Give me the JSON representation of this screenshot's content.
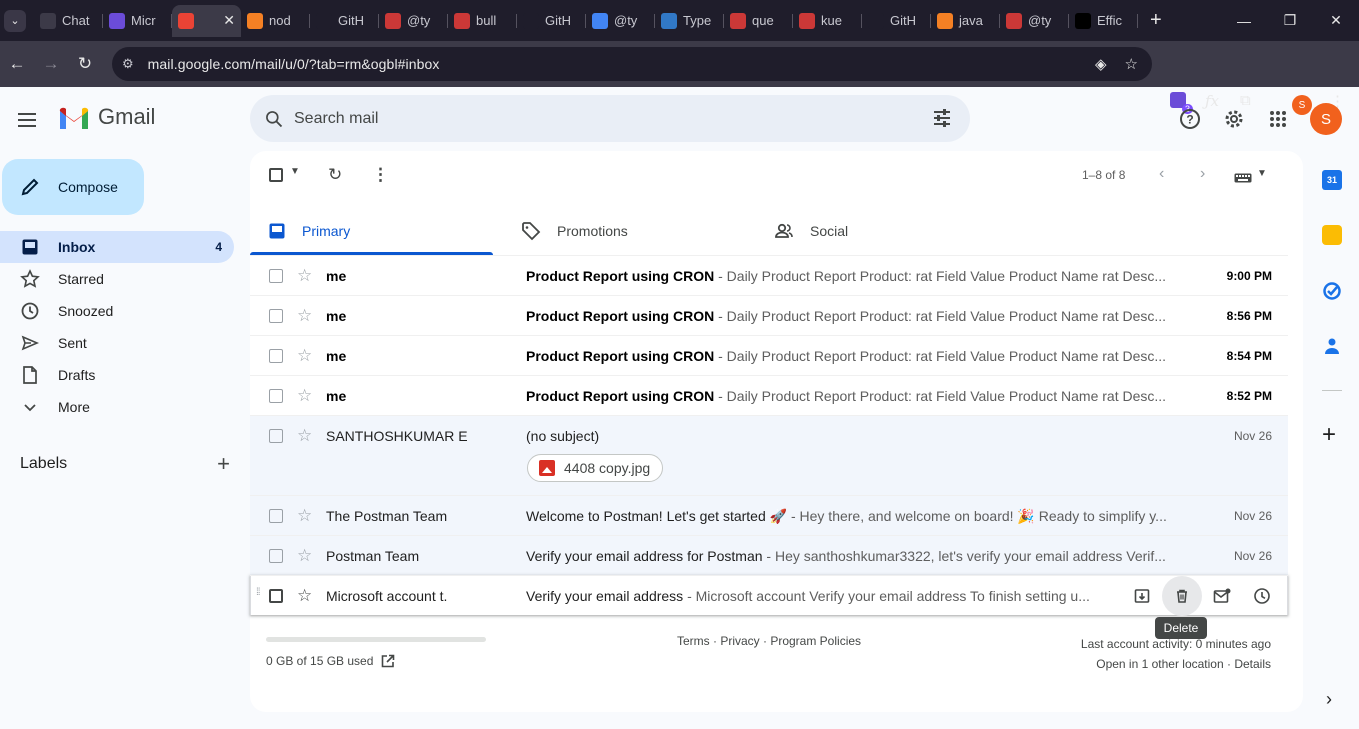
{
  "browser": {
    "tabs": [
      {
        "label": "Chat",
        "icon": "chatgpt-icon",
        "color": "#3c3a48"
      },
      {
        "label": "Micr",
        "icon": "copilot-icon",
        "color": "#6b4cd8"
      },
      {
        "label": "",
        "icon": "gmail-icon",
        "color": "#ea4335",
        "active": true
      },
      {
        "label": "nod",
        "icon": "stackoverflow-icon",
        "color": "#f48024"
      },
      {
        "label": "GitH",
        "icon": "github-icon",
        "color": "#1f1d2b"
      },
      {
        "label": "@ty",
        "icon": "npm-icon",
        "color": "#cb3837"
      },
      {
        "label": "bull",
        "icon": "npm-icon",
        "color": "#cb3837"
      },
      {
        "label": "GitH",
        "icon": "github-icon",
        "color": "#1f1d2b"
      },
      {
        "label": "@ty",
        "icon": "google-icon",
        "color": "#4285f4"
      },
      {
        "label": "Type",
        "icon": "typescript-icon",
        "color": "#3178c6"
      },
      {
        "label": "que",
        "icon": "npm-icon",
        "color": "#cb3837"
      },
      {
        "label": "kue",
        "icon": "npm-icon",
        "color": "#cb3837"
      },
      {
        "label": "GitH",
        "icon": "github-icon",
        "color": "#1f1d2b"
      },
      {
        "label": "java",
        "icon": "stackoverflow-icon",
        "color": "#f48024"
      },
      {
        "label": "@ty",
        "icon": "npm-icon",
        "color": "#cb3837"
      },
      {
        "label": "Effic",
        "icon": "medium-icon",
        "color": "#000000"
      }
    ],
    "url": "mail.google.com/mail/u/0/?tab=rm&ogbl#inbox",
    "extension_badge": "3",
    "profile_initial": "S"
  },
  "gmail": {
    "product_name": "Gmail",
    "search_placeholder": "Search mail",
    "avatar_initial": "S",
    "compose_label": "Compose",
    "nav": [
      {
        "label": "Inbox",
        "icon": "inbox-icon",
        "count": "4",
        "active": true
      },
      {
        "label": "Starred",
        "icon": "star-icon",
        "count": ""
      },
      {
        "label": "Snoozed",
        "icon": "clock-icon",
        "count": ""
      },
      {
        "label": "Sent",
        "icon": "send-icon",
        "count": ""
      },
      {
        "label": "Drafts",
        "icon": "draft-icon",
        "count": ""
      },
      {
        "label": "More",
        "icon": "chevron-down-icon",
        "count": ""
      }
    ],
    "labels_heading": "Labels",
    "pagination": "1–8 of 8",
    "inbox_tabs": [
      {
        "label": "Primary",
        "icon": "inbox-icon",
        "active": true
      },
      {
        "label": "Promotions",
        "icon": "tag-icon"
      },
      {
        "label": "Social",
        "icon": "people-icon"
      }
    ],
    "emails": [
      {
        "sender": "me",
        "subject": "Product Report using CRON",
        "snippet": " - Daily Product Report Product: rat Field Value Product Name rat Desc...",
        "date": "9:00 PM",
        "unread": true
      },
      {
        "sender": "me",
        "subject": "Product Report using CRON",
        "snippet": " - Daily Product Report Product: rat Field Value Product Name rat Desc...",
        "date": "8:56 PM",
        "unread": true
      },
      {
        "sender": "me",
        "subject": "Product Report using CRON",
        "snippet": " - Daily Product Report Product: rat Field Value Product Name rat Desc...",
        "date": "8:54 PM",
        "unread": true
      },
      {
        "sender": "me",
        "subject": "Product Report using CRON",
        "snippet": " - Daily Product Report Product: rat Field Value Product Name rat Desc...",
        "date": "8:52 PM",
        "unread": true
      },
      {
        "sender": "SANTHOSHKUMAR E",
        "subject": "(no subject)",
        "snippet": "",
        "date": "Nov 26",
        "unread": false,
        "attachment": "4408 copy.jpg"
      },
      {
        "sender": "The Postman Team",
        "subject": "Welcome to Postman! Let's get started 🚀",
        "snippet": " - Hey there, and welcome on board! 🎉 Ready to simplify y...",
        "date": "Nov 26",
        "unread": false
      },
      {
        "sender": "Postman Team",
        "subject": "Verify your email address for Postman",
        "snippet": " - Hey santhoshkumar3322, let's verify your email address Verif...",
        "date": "Nov 26",
        "unread": false
      },
      {
        "sender": "Microsoft account t.",
        "subject": "Verify your email address",
        "snippet": " - Microsoft account Verify your email address To finish setting u...",
        "date": "",
        "unread": false,
        "hovered": true
      }
    ],
    "tooltip": "Delete",
    "storage": "0 GB of 15 GB used",
    "footer_links": "Terms · Privacy · Program Policies",
    "last_activity": "Last account activity: 0 minutes ago",
    "other_location": "Open in 1 other location · Details",
    "side_panel": [
      {
        "name": "calendar-icon",
        "text": "31",
        "color": "#1a73e8"
      },
      {
        "name": "keep-icon",
        "text": "",
        "color": "#fbbc04"
      },
      {
        "name": "tasks-icon",
        "text": "",
        "color": "#1a73e8"
      },
      {
        "name": "contacts-icon",
        "text": "",
        "color": "#1a73e8"
      }
    ]
  }
}
